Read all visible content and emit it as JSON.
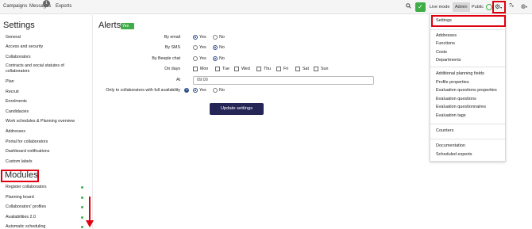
{
  "topbar": {
    "campaigns": "Campaigns",
    "messages": "Messages",
    "messages_badge": "1",
    "exports": "Exports",
    "search_icon": "search-icon",
    "live_mode": "Live mode",
    "admin": "Admin",
    "public": "Public",
    "caret": "▾"
  },
  "sidebar": {
    "settings_title": "Settings",
    "settings_items": [
      "General",
      "Access and security",
      "Collaborators",
      "Contracts and social statutes of collaborators",
      "Plan",
      "Recruit",
      "Enrolments",
      "Candidacies",
      "Work schedules & Planning overview",
      "Addresses",
      "Portal for collaborators",
      "Dashboard notifications",
      "Custom labels"
    ],
    "modules_title": "Modules",
    "module_items": [
      "Register collaborators",
      "Planning board",
      "Collaborators' profiles",
      "Availabilities 2.0",
      "Automatic scheduling"
    ]
  },
  "alerts": {
    "title": "Alerts",
    "badge": "Yes",
    "by_email": "By email",
    "by_sms": "By SMS",
    "by_beeple_chat": "By Beeple chat",
    "on_days": "On days",
    "at": "At",
    "only_full_availability": "Only to collaborators with full availability",
    "yes": "Yes",
    "no": "No",
    "days": [
      "Mon",
      "Tue",
      "Wed",
      "Thu",
      "Fri",
      "Sat",
      "Sun"
    ],
    "time_value": "09:00",
    "update_button": "Update settings",
    "selections": {
      "by_email": "Yes",
      "by_sms": "No",
      "by_beeple_chat": "No",
      "only_full_availability": "Yes"
    }
  },
  "dropdown": {
    "items": [
      "Settings",
      "Addresses",
      "Functions",
      "Costs",
      "Departments",
      "Additional planning fields",
      "Profile properties",
      "Evaluation questions properties",
      "Evaluation questions",
      "Evaluation questionnaires",
      "Evaluation tags",
      "Counters",
      "Documentation",
      "Scheduled exports"
    ]
  },
  "colors": {
    "brand_green": "#3fae49",
    "highlight_red": "#e0000f",
    "button_navy": "#262656",
    "radio_blue": "#2e4c8c"
  }
}
